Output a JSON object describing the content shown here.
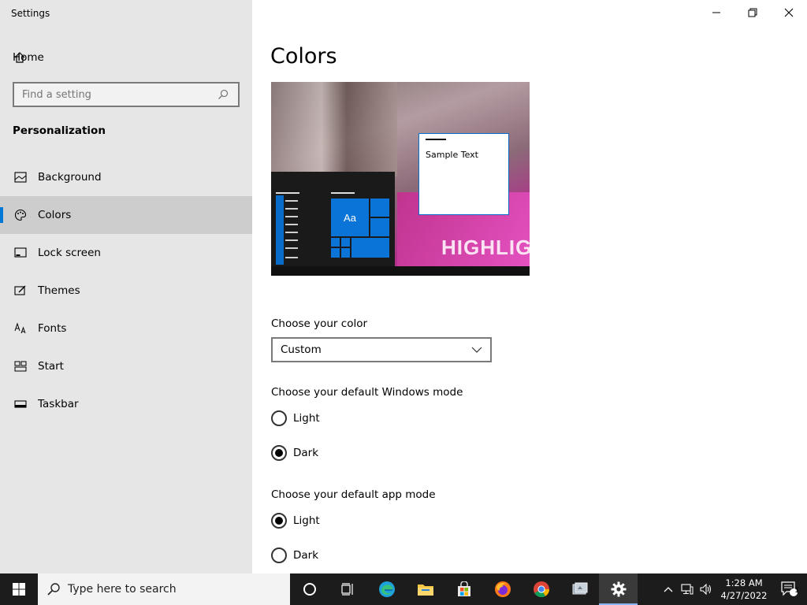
{
  "window": {
    "title": "Settings",
    "controls": [
      "minimize",
      "restore",
      "close"
    ]
  },
  "sidebar": {
    "home_label": "Home",
    "search_placeholder": "Find a setting",
    "section_title": "Personalization",
    "items": [
      {
        "label": "Background",
        "icon": "image-icon"
      },
      {
        "label": "Colors",
        "icon": "palette-icon",
        "active": true
      },
      {
        "label": "Lock screen",
        "icon": "lock-screen-icon"
      },
      {
        "label": "Themes",
        "icon": "themes-icon"
      },
      {
        "label": "Fonts",
        "icon": "fonts-icon"
      },
      {
        "label": "Start",
        "icon": "start-icon"
      },
      {
        "label": "Taskbar",
        "icon": "taskbar-icon"
      }
    ]
  },
  "main": {
    "title": "Colors",
    "preview": {
      "sample_text": "Sample Text",
      "tile_text": "Aa",
      "wallpaper_text": "HIGHLIGH"
    },
    "choose_color_label": "Choose your color",
    "choose_color_value": "Custom",
    "windows_mode_label": "Choose your default Windows mode",
    "windows_mode_options": [
      {
        "label": "Light",
        "checked": false
      },
      {
        "label": "Dark",
        "checked": true
      }
    ],
    "app_mode_label": "Choose your default app mode",
    "app_mode_options": [
      {
        "label": "Light",
        "checked": true
      },
      {
        "label": "Dark",
        "checked": false
      }
    ]
  },
  "taskbar": {
    "search_placeholder": "Type here to search",
    "time": "1:28 AM",
    "date": "4/27/2022",
    "notification_count": "1",
    "apps": [
      "task-view-icon",
      "cortana-icon",
      "edge-icon",
      "file-explorer-icon",
      "store-icon",
      "firefox-icon",
      "chrome-icon",
      "app-icon",
      "settings-gear-icon"
    ]
  },
  "colors": {
    "accent": "#0078d7",
    "sidebar_bg": "#e6e6e6",
    "taskbar_bg": "#1c1c1c"
  }
}
